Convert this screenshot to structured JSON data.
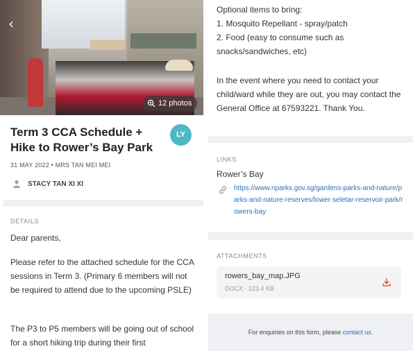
{
  "hero": {
    "photos_count": "12 photos"
  },
  "post": {
    "title": "Term 3 CCA Schedule + Hike to Rower’s Bay Park",
    "avatar_initials": "LY",
    "meta": "31 MAY 2022 • MRS TAN MEI MEI",
    "student": "STACY TAN XI XI"
  },
  "details": {
    "label": "DETAILS",
    "greeting": "Dear parents,",
    "para1": "Please refer to the attached schedule for the CCA sessions in Term 3. (Primary 6 members will not be required to attend due to the upcoming PSLE)",
    "para2": "The P3 to P5 members will be going out of school for a short hiking trip during their first"
  },
  "right": {
    "optional_lines": [
      "Optional items to bring:",
      "1. Mosquito Repellant - spray/patch",
      "2. Food (easy to consume such as snacks/sandwiches, etc)"
    ],
    "contact": "In the event where you need to contact your child/ward while they are out, you may contact the General Office at 67593221. Thank You."
  },
  "links": {
    "label": "LINKS",
    "name": "Rower’s Bay",
    "url": "https://www.nparks.gov.sg/gardens-parks-and-nature/parks-and-nature-reserves/lower-seletar-reservoir-park/rowers-bay"
  },
  "attachments": {
    "label": "ATTACHMENTS",
    "file_name": "rowers_bay_map.JPG",
    "file_meta": "DOCX · 123.4 KB"
  },
  "footer": {
    "text": "For enquiries on this form, please ",
    "link": "contact us",
    "end": "."
  },
  "colors": {
    "avatar": "#4fb8c5",
    "link": "#2c6fb7",
    "download": "#e0603c"
  },
  "icons": [
    "back-arrow-icon",
    "zoom-photos-icon",
    "person-icon",
    "link-icon",
    "download-icon"
  ]
}
